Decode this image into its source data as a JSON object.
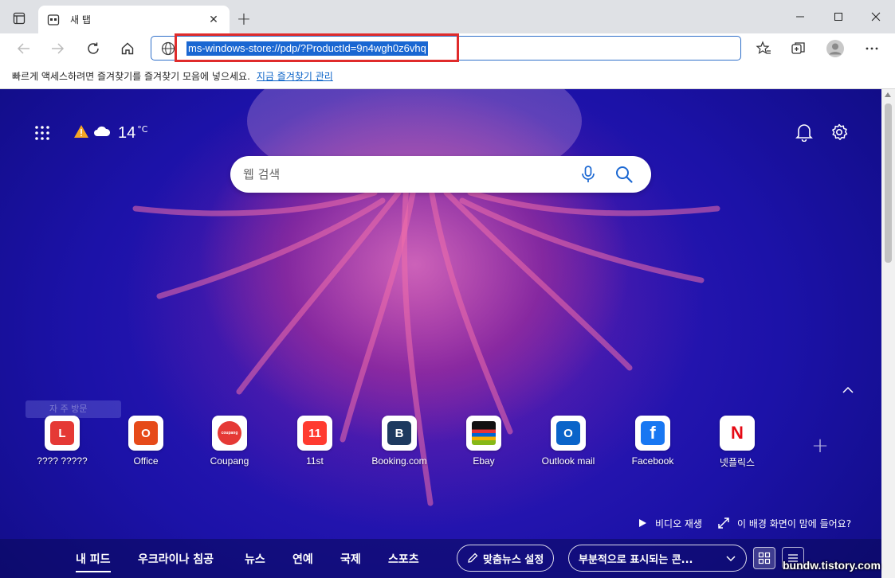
{
  "tab": {
    "title": "새 탭",
    "close_label": "✕"
  },
  "newtab_label": "+",
  "window_controls": {
    "minimize": "—",
    "maximize": "☐",
    "close": "✕"
  },
  "address": {
    "url": "ms-windows-store://pdp/?ProductId=9n4wgh0z6vhq"
  },
  "favorites_bar": {
    "text": "빠르게 액세스하려면 즐겨찾기를 즐겨찾기 모음에 넣으세요.",
    "link": "지금 즐겨찾기 관리"
  },
  "weather": {
    "temp": "14",
    "unit": "°C"
  },
  "search": {
    "placeholder": "웹 검색"
  },
  "ghost_label": "자 주 방문",
  "tiles": [
    {
      "label": "???? ?????",
      "icon": "l-letter-icon",
      "color": "#e53935",
      "glyph": "L"
    },
    {
      "label": "Office",
      "icon": "office-icon",
      "color": "#e64a19",
      "glyph": "O"
    },
    {
      "label": "Coupang",
      "icon": "coupang-icon",
      "color": "#e53935",
      "glyph": "coupang"
    },
    {
      "label": "11st",
      "icon": "11st-icon",
      "color": "#ff3b2f",
      "glyph": "11"
    },
    {
      "label": "Booking.com",
      "icon": "booking-icon",
      "color": "#1e3a5f",
      "glyph": "B"
    },
    {
      "label": "Ebay",
      "icon": "ebay-bag-icon",
      "color": "#111",
      "glyph": ""
    },
    {
      "label": "Outlook mail",
      "icon": "outlook-icon",
      "color": "#0a64c9",
      "glyph": "O"
    },
    {
      "label": "Facebook",
      "icon": "facebook-icon",
      "color": "#1877f2",
      "glyph": "f"
    },
    {
      "label": "넷플릭스",
      "icon": "netflix-icon",
      "color": "#e50914",
      "glyph": "N"
    }
  ],
  "video": {
    "play": "비디오 재생",
    "like": "이 배경 화면이 맘에 들어요?"
  },
  "feed": {
    "tabs": [
      "내 피드",
      "우크라이나 침공",
      "뉴스",
      "연예",
      "국제",
      "스포츠"
    ],
    "personalize": "맞춤뉴스 설정",
    "content_select": "부분적으로 표시되는 콘..."
  },
  "watermark": "bundw.tistory.com"
}
